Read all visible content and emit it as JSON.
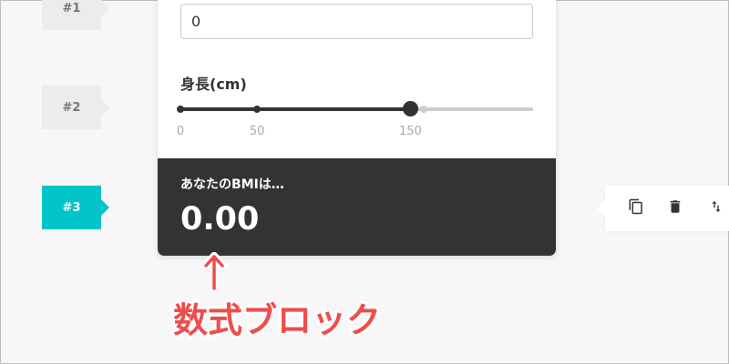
{
  "steps": [
    {
      "label": "#1",
      "active": false
    },
    {
      "label": "#2",
      "active": false
    },
    {
      "label": "#3",
      "active": true
    }
  ],
  "form": {
    "number_field_value": "0",
    "height_label": "身長(cm)",
    "slider": {
      "min": 0,
      "max": 230,
      "value": 150,
      "ticks": [
        0,
        50,
        150
      ],
      "tick_labels": [
        "0",
        "50",
        "150"
      ]
    }
  },
  "result": {
    "label": "あなたのBMIは…",
    "value": "0.00"
  },
  "toolbar": {
    "icons": [
      "copy-icon",
      "trash-icon",
      "swap-vertical-icon"
    ]
  },
  "annotation": {
    "arrow": "↑",
    "text": "数式ブロック"
  },
  "colors": {
    "accent": "#00c4c8",
    "dark": "#333333",
    "annotation": "#ef4d4d",
    "track_inactive": "#cccccc"
  }
}
